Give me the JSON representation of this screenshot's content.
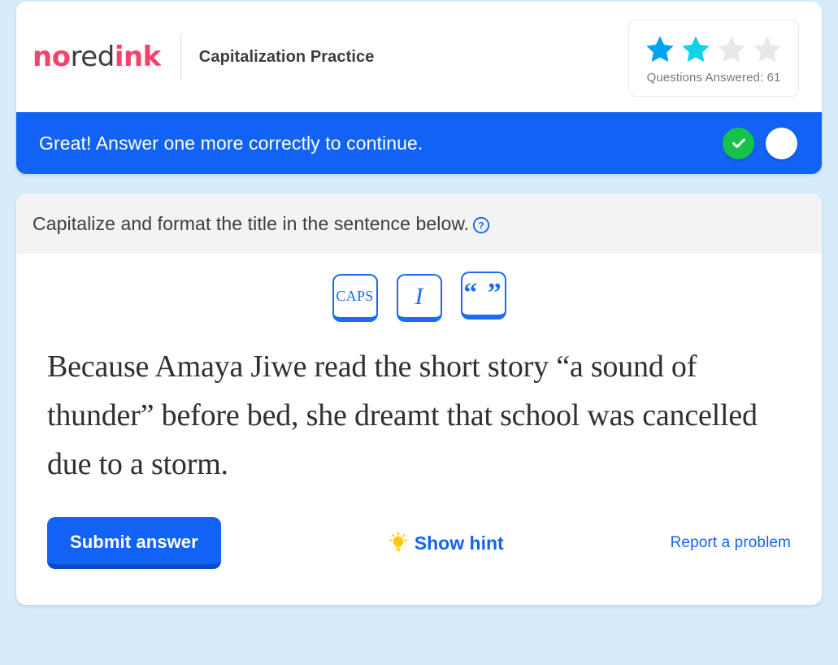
{
  "header": {
    "logo": {
      "part1": "no",
      "part2": "red",
      "part3": "ink"
    },
    "title": "Capitalization Practice"
  },
  "progress": {
    "questions_answered_label": "Questions Answered: 61",
    "stars": [
      {
        "state": "filled",
        "color": "#00a2f3"
      },
      {
        "state": "filled",
        "color": "#12d2e8"
      },
      {
        "state": "empty",
        "color": "#e8e8e8"
      },
      {
        "state": "empty",
        "color": "#e8e8e8"
      }
    ]
  },
  "banner": {
    "message": "Great! Answer one more correctly to continue.",
    "background_color": "#1263f5",
    "dots": [
      {
        "state": "correct",
        "icon": "check-icon",
        "color": "#17c24a"
      },
      {
        "state": "empty",
        "icon": "",
        "color": "#ffffff"
      }
    ]
  },
  "question": {
    "instruction": "Capitalize and format the title in the sentence below.",
    "help_icon": "question-mark-icon",
    "format_buttons": [
      {
        "name": "caps-button",
        "label": "CAPS"
      },
      {
        "name": "italic-button",
        "label": "I"
      },
      {
        "name": "quotation-button",
        "label": "“ ”"
      }
    ],
    "sentence": "Because Amaya Jiwe read the short story “a sound of thunder” before bed, she dreamt that school was cancelled due to a storm."
  },
  "actions": {
    "submit_label": "Submit answer",
    "hint_label": "Show hint",
    "hint_icon": "lightbulb-icon",
    "report_label": "Report a problem"
  },
  "theme": {
    "page_background": "#d6ecfa",
    "brand_pink": "#f5426c",
    "accent_blue": "#1263f5",
    "instruction_bar": "#f3f3f3"
  }
}
